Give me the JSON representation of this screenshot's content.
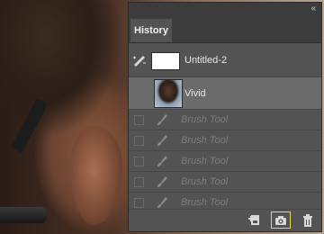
{
  "panel": {
    "collapse_icon": "double-chevron-left-icon",
    "tab_label": "History"
  },
  "snapshot": {
    "label": "Untitled-2",
    "source_icon": "history-brush-icon"
  },
  "states": [
    {
      "label": "Vivid",
      "selected": true
    },
    {
      "label": "Brush Tool",
      "greyed": true
    },
    {
      "label": "Brush Tool",
      "greyed": true
    },
    {
      "label": "Brush Tool",
      "greyed": true
    },
    {
      "label": "Brush Tool",
      "greyed": true
    },
    {
      "label": "Brush Tool",
      "greyed": true
    }
  ],
  "bottom_toolbar": {
    "buttons": [
      "new-document-from-state-icon",
      "camera-icon",
      "trash-icon"
    ]
  },
  "colors": {
    "panel_bg": "#535353",
    "selected_row": "#6b6b6b",
    "highlight": "#e8d94a"
  }
}
